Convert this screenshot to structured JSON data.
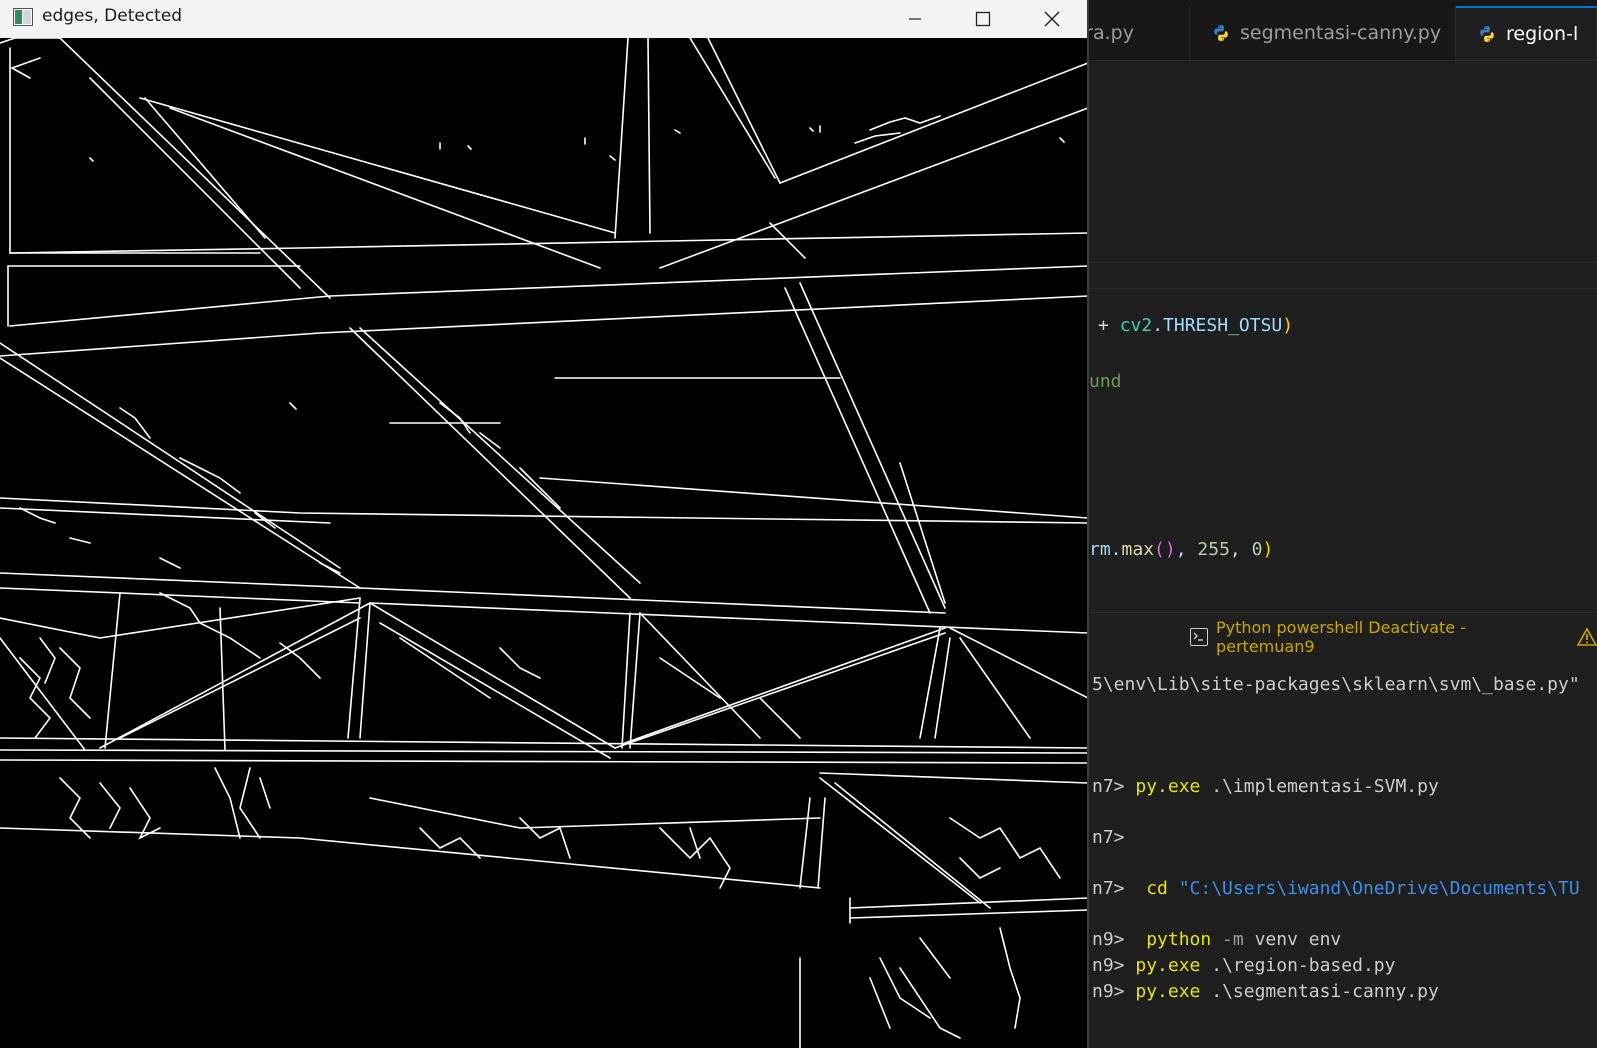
{
  "vscode": {
    "tabs": [
      {
        "label": "citra.py",
        "active": false
      },
      {
        "label": "segmentasi-canny.py",
        "active": false
      },
      {
        "label": "region-l",
        "active": true
      }
    ],
    "code": {
      "line1": {
        "t1": "+ ",
        "t2": "cv2",
        "t3": ".",
        "t4": "THRESH_OTSU",
        "t5": ")"
      },
      "line2": "und",
      "line3": {
        "t1": "rm.",
        "t2": "max",
        "t3": "()",
        "t4": ", ",
        "t5": "255",
        "t6": ", ",
        "t7": "0",
        "t8": ")"
      }
    },
    "terminal": {
      "header": "Python powershell Deactivate - pertemuan9",
      "lines": {
        "l1": "5\\env\\Lib\\site-packages\\sklearn\\svm\\_base.py\"",
        "l2_prompt": "n7> ",
        "l2_cmd": "py.exe",
        "l2_arg": " .\\implementasi-SVM.py",
        "l3_prompt": "n7>",
        "l4_prompt": "n7>  ",
        "l4_cmd": "cd",
        "l4_arg": " \"C:\\Users\\iwand\\OneDrive\\Documents\\TU",
        "l5_prompt": "n9>  ",
        "l5_cmd": "python",
        "l5_flag": " -m",
        "l5_arg": " venv env",
        "l6_prompt": "n9> ",
        "l6_cmd": "py.exe",
        "l6_arg": " .\\region-based.py",
        "l7_prompt": "n9> ",
        "l7_cmd": "py.exe",
        "l7_arg": " .\\segmentasi-canny.py"
      }
    }
  },
  "window": {
    "title": "edges, Detected",
    "buttons": [
      "minimize-icon",
      "maximize-icon",
      "close-icon"
    ]
  },
  "image": {
    "description_icon": "canny-edge-output",
    "colors": {
      "edges": "#ffffff",
      "background": "#000000"
    }
  }
}
